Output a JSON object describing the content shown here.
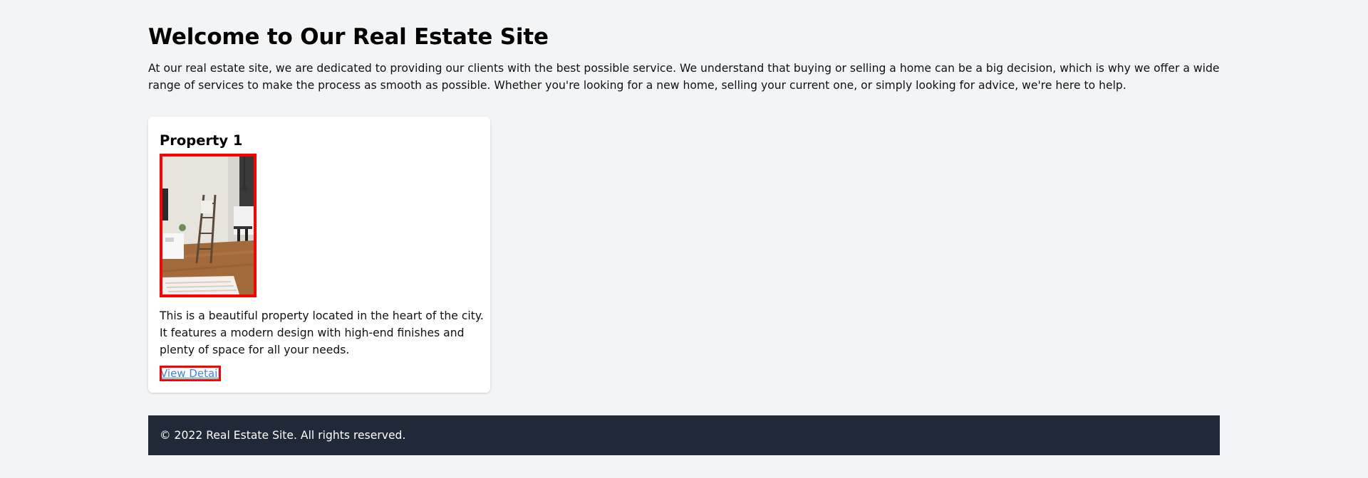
{
  "header": {
    "title": "Welcome to Our Real Estate Site",
    "intro": "At our real estate site, we are dedicated to providing our clients with the best possible service. We understand that buying or selling a home can be a big decision, which is why we offer a wide range of services to make the process as smooth as possible. Whether you're looking for a new home, selling your current one, or simply looking for advice, we're here to help."
  },
  "properties": [
    {
      "title": "Property 1",
      "image_alt": "interior photo with ladder shelf and wooden floor",
      "description": "This is a beautiful property located in the heart of the city. It features a modern design with high-end finishes and plenty of space for all your needs.",
      "link_label": "View Details"
    }
  ],
  "footer": {
    "text": "© 2022 Real Estate Site. All rights reserved."
  },
  "colors": {
    "background": "#f3f4f6",
    "footer_bg": "#1f2937",
    "link": "#3b82f6",
    "highlight_border": "#ff0000"
  }
}
